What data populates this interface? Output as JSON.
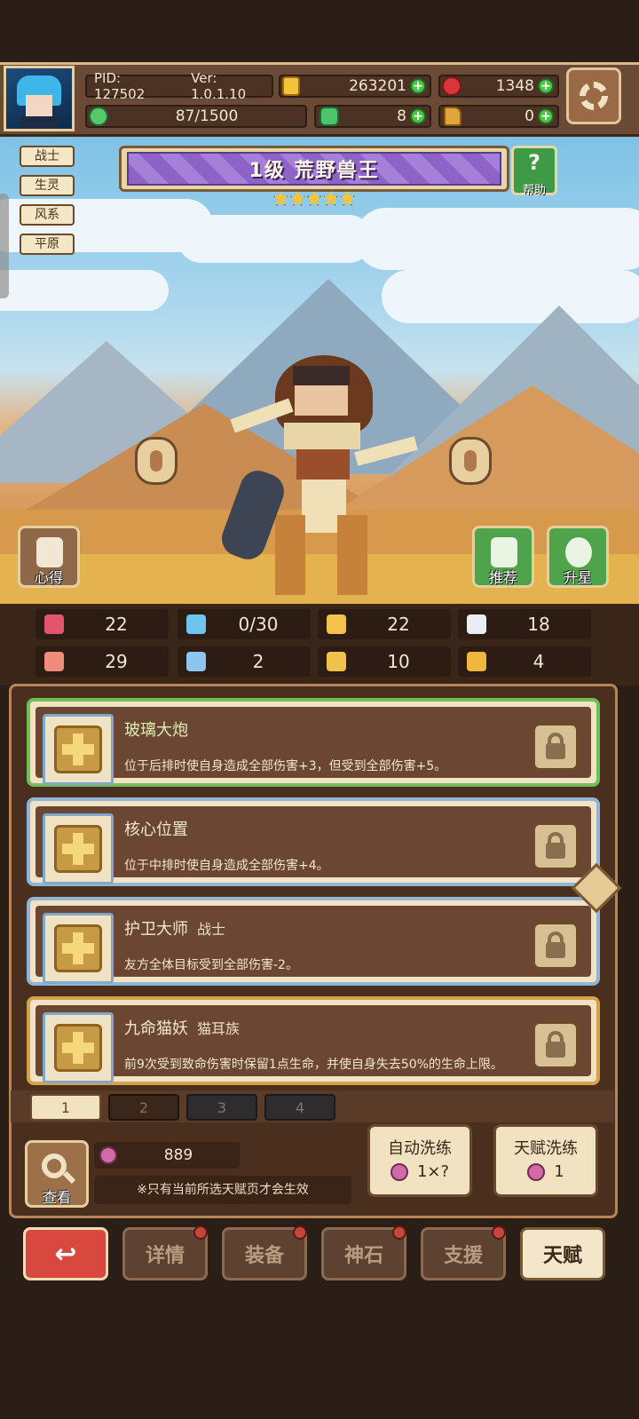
{
  "header": {
    "pid": "PID: 127502",
    "version": "Ver: 1.0.1.10",
    "gold": "263201",
    "gems": "1348",
    "energy": "87/1500",
    "clover": "8",
    "boots": "0"
  },
  "tags": [
    "战士",
    "生灵",
    "风系",
    "平原"
  ],
  "hero": {
    "title": "1级  荒野兽王",
    "stars": 5,
    "help_label": "帮助"
  },
  "side_buttons": {
    "insight": "心得",
    "recommend": "推荐",
    "star_up": "升星"
  },
  "stats": [
    {
      "icon": "heart-icon",
      "value": "22"
    },
    {
      "icon": "water-drop-icon",
      "value": "0/30"
    },
    {
      "icon": "shield-icon",
      "value": "22"
    },
    {
      "icon": "wing-icon",
      "value": "18"
    },
    {
      "icon": "fist-icon",
      "value": "29"
    },
    {
      "icon": "book-icon",
      "value": "2"
    },
    {
      "icon": "boot-icon",
      "value": "10"
    },
    {
      "icon": "horseshoe-icon",
      "value": "4"
    }
  ],
  "talents": [
    {
      "name": "玻璃大炮",
      "sub": "",
      "desc": "位于后排时使自身造成全部伤害+3，但受到全部伤害+5。",
      "border": "#6fbf5a"
    },
    {
      "name": "核心位置",
      "sub": "",
      "desc": "位于中排时使自身造成全部伤害+4。",
      "border": "#8fb4d6"
    },
    {
      "name": "护卫大师",
      "sub": "战士",
      "desc": "友方全体目标受到全部伤害-2。",
      "border": "#8fb4d6"
    },
    {
      "name": "九命猫妖",
      "sub": "猫耳族",
      "desc": "前9次受到致命伤害时保留1点生命，并使自身失去50%的生命上限。",
      "border": "#d4a24c"
    }
  ],
  "pages": [
    "1",
    "2",
    "3",
    "4"
  ],
  "bottom": {
    "search_label": "查看",
    "potions": "889",
    "note": "※只有当前所选天赋页才会生效",
    "auto_wash": {
      "title": "自动洗练",
      "cost": "1×?"
    },
    "talent_wash": {
      "title": "天赋洗练",
      "cost": "1"
    }
  },
  "nav": {
    "details": "详情",
    "equip": "装备",
    "stone": "神石",
    "support": "支援",
    "talent": "天赋"
  }
}
